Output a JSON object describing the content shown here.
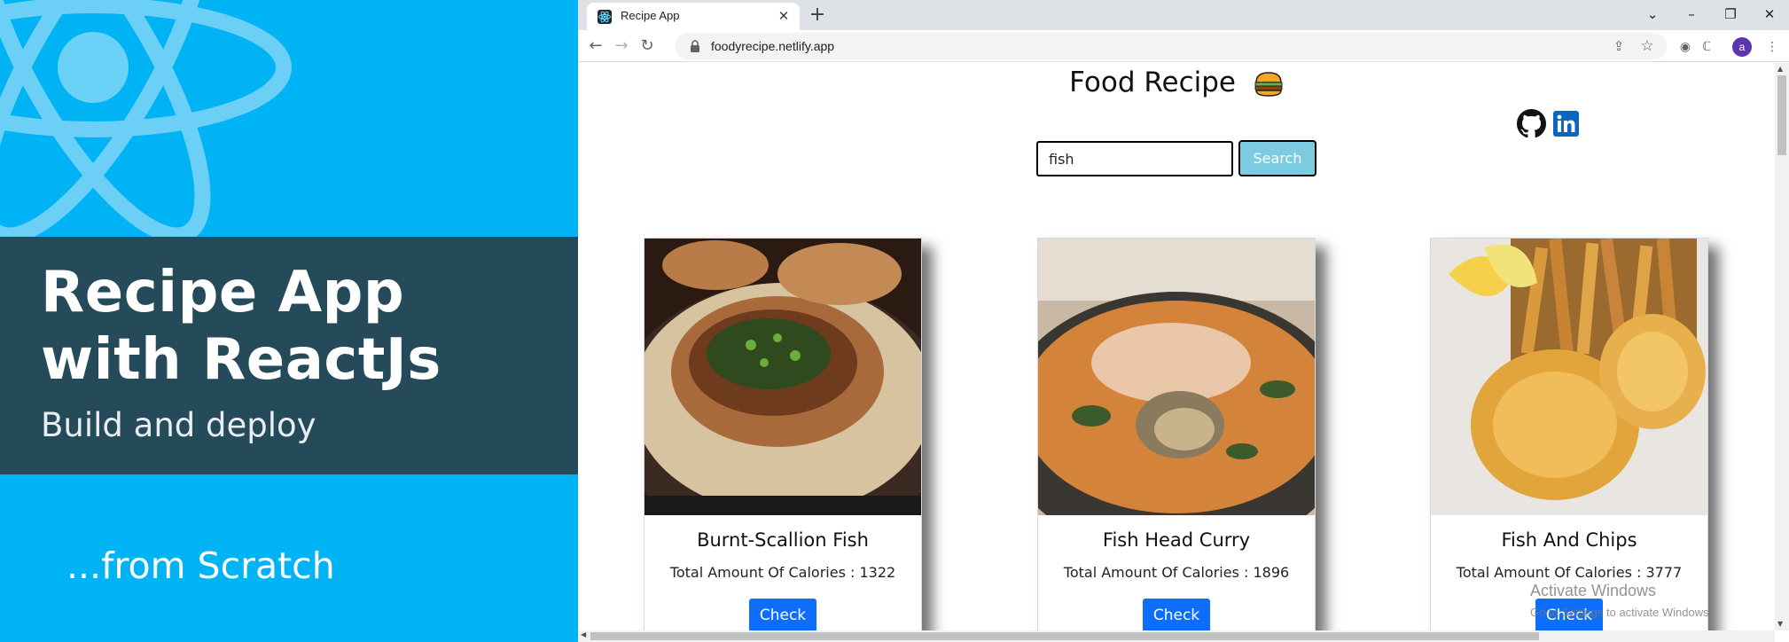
{
  "banner": {
    "title": "Recipe App with ReactJs",
    "subtitle": "Build and deploy",
    "tagline": "...from Scratch"
  },
  "browser": {
    "tab_title": "Recipe App",
    "url": "foodyrecipe.netlify.app",
    "avatar_letter": "a"
  },
  "page": {
    "title": "Food Recipe",
    "search": {
      "value": "fish",
      "button": "Search"
    },
    "cards": [
      {
        "title": "Burnt-Scallion Fish",
        "calories": "Total Amount Of Calories : 1322",
        "button": "Check"
      },
      {
        "title": "Fish Head Curry",
        "calories": "Total Amount Of Calories : 1896",
        "button": "Check"
      },
      {
        "title": "Fish And Chips",
        "calories": "Total Amount Of Calories : 3777",
        "button": "Check"
      }
    ]
  },
  "watermark": {
    "line1": "Activate Windows",
    "line2": "Go to Settings to activate Windows."
  },
  "colors": {
    "banner_blue": "#00b3f5",
    "banner_dark": "#254a5a",
    "check_button": "#0d6efd",
    "search_button": "#7ccbe0"
  }
}
